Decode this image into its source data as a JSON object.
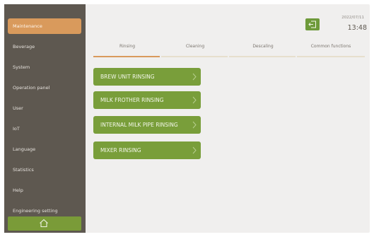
{
  "sidebar": {
    "items": [
      {
        "label": "Maintenance"
      },
      {
        "label": "Beverage"
      },
      {
        "label": "System"
      },
      {
        "label": "Operation panel"
      },
      {
        "label": "User"
      },
      {
        "label": "IoT"
      },
      {
        "label": "Language"
      },
      {
        "label": "Statistics"
      },
      {
        "label": "Help"
      },
      {
        "label": "Engineering setting"
      }
    ],
    "active_index": 0
  },
  "header": {
    "date": "2022/07/11",
    "time": "13:48"
  },
  "tabs": [
    {
      "label": "Rinsing",
      "active": true
    },
    {
      "label": "Cleaning",
      "active": false
    },
    {
      "label": "Descaling",
      "active": false
    },
    {
      "label": "Common functions",
      "active": false
    }
  ],
  "actions": [
    {
      "label": "BREW UNIT RINSING"
    },
    {
      "label": "MILK FROTHER RINSING"
    },
    {
      "label": "INTERNAL MILK PIPE RINSING"
    },
    {
      "label": "MIXER RINSING"
    }
  ],
  "icons": {
    "home": "home-icon",
    "back": "exit-icon",
    "chevron": "chevron-right-icon"
  },
  "colors": {
    "sidebar_bg": "#5e5850",
    "active_menu": "#d99a5c",
    "button_green": "#799e3a",
    "content_bg": "#f0efee"
  }
}
